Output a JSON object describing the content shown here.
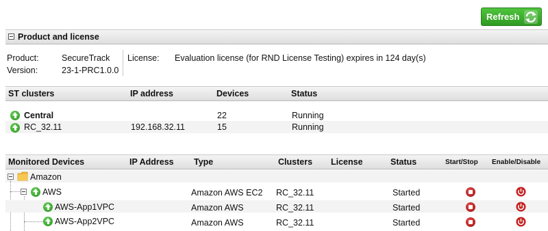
{
  "toolbar": {
    "refresh_label": "Refresh"
  },
  "product_section": {
    "title": "Product and license",
    "product_label": "Product:",
    "product_value": "SecureTrack",
    "version_label": "Version:",
    "version_value": "23-1-PRC1.0.0",
    "license_label": "License:",
    "license_value": "Evaluation license (for RND License Testing) expires in 124 day(s)"
  },
  "clusters_section": {
    "columns": [
      "ST clusters",
      "IP address",
      "Devices",
      "Status"
    ],
    "rows": [
      {
        "name": "Central",
        "ip": "",
        "devices": "22",
        "status": "Running"
      },
      {
        "name": "RC_32.11",
        "ip": "192.168.32.11",
        "devices": "15",
        "status": "Running"
      }
    ]
  },
  "devices_section": {
    "columns": [
      "Monitored Devices",
      "IP Address",
      "Type",
      "Clusters",
      "License",
      "Status",
      "Start/Stop",
      "Enable/Disable"
    ],
    "tree": {
      "root": "Amazon",
      "group": "AWS",
      "group_type": "Amazon AWS EC2",
      "group_cluster": "RC_32.11",
      "group_status": "Started",
      "children": [
        {
          "name": "AWS-App1VPC",
          "type": "Amazon AWS",
          "cluster": "RC_32.11",
          "status": "Started"
        },
        {
          "name": "AWS-App2VPC",
          "type": "Amazon AWS",
          "cluster": "RC_32.11",
          "status": "Started"
        }
      ]
    }
  },
  "icons": {
    "refresh": "refresh-icon",
    "status_up": "status-up-icon",
    "stop": "stop-icon",
    "power": "power-icon",
    "folder": "folder-icon"
  },
  "colors": {
    "refresh_green": "#3aa92a",
    "stop_red": "#b71c1c",
    "up_green": "#2b8e1f"
  }
}
